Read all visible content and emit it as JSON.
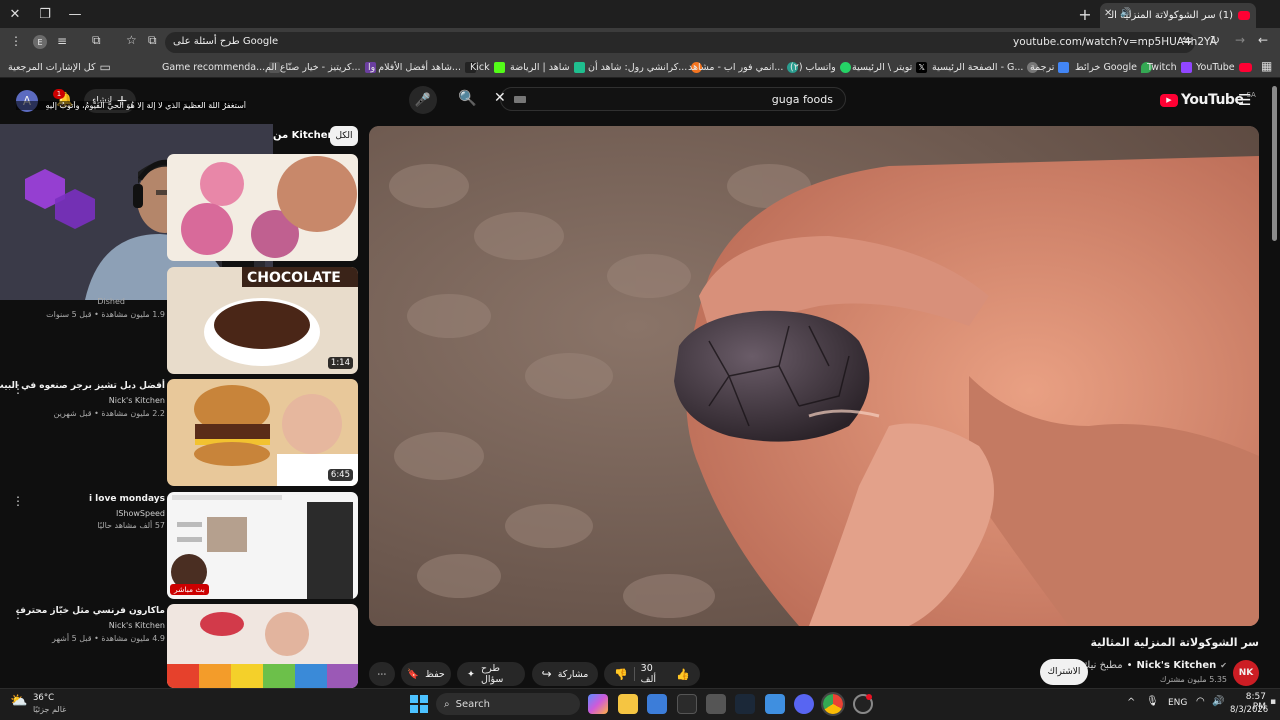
{
  "browser": {
    "tab_title": "(1) سر الشوكولاتة المنزلية الـ",
    "new_tab_symbol": "+",
    "url": "youtube.com/watch?v=mp5HUA4h2YA",
    "ask_google": "طرح أسئلة على Google",
    "profile_letter": "E",
    "bookmarks": [
      "YouTube",
      "Twitch",
      "خرائط Google",
      "ترجمة",
      "الصفحة الرئيسية - G...",
      "تويتر \\ الرئيسية",
      "واتساب (٢)",
      "انمي فور اب - مشاهد...",
      "كرانشي رول: شاهد أن...",
      "شاهد | الرياضة",
      "Kick",
      "شاهد أفضل الأفلام وا...",
      "كريتيز - خيار صنّاع الم...",
      "Game recommenda..."
    ],
    "bookmarks_folder": "كل الإشارات المرجعية"
  },
  "youtube": {
    "logo": "YouTube",
    "region": "SA",
    "search_query": "guga foods",
    "avatar_letter": "A",
    "notif_count": "1",
    "create_label": "إنشاء",
    "ticker_text": "أستغفرُ اللهَ العظيمَ الذي لا إلهَ إلا هُوَ الحيُّ القيُّومُ، وأتوبُ إليهِ",
    "chips": [
      "الكل",
      "من Kitchen"
    ]
  },
  "video": {
    "title": "سر الشوكولاتة المنزلية المثالية",
    "channel": "Nick's Kitchen",
    "channel_ar": "مطبخ نيك",
    "channel_initials": "NK",
    "subscribers": "5.35 مليون مشترك",
    "subscribe": "الاشتراك",
    "likes": "30 ألف",
    "share": "مشاركة",
    "ask": "طرح سؤال",
    "save": "حفظ"
  },
  "sidebar": [
    {
      "title": "",
      "channel": "Dished",
      "meta": "1.9 مليون مشاهدة • قبل 5 سنوات",
      "duration": "1:14",
      "thumb_text": "CHOCOLATE"
    },
    {
      "title": "أفضل دبل تشيز برجر صنعوه في البيت",
      "channel": "Nick's Kitchen",
      "meta": "2.2 مليون مشاهدة • قبل شهرين",
      "duration": "6:45"
    },
    {
      "title": "i love mondays",
      "channel": "IShowSpeed",
      "meta": "57 ألف مشاهد حاليًا",
      "live": "بث مباشر"
    },
    {
      "title": "ماكارون فرنسي مثل خبّاز محترف",
      "channel": "Nick's Kitchen",
      "meta": "4.9 مليون مشاهدة • قبل 5 أشهر"
    }
  ],
  "taskbar": {
    "weather_temp": "36°C",
    "weather_desc": "غالم جزئيًا",
    "search": "Search",
    "lang": "ENG",
    "time": "8:57 PM",
    "date": "8/3/2026"
  },
  "colors": {
    "youtube_red": "#ff0033",
    "bg": "#0f0f0f",
    "chrome": "#3c3c3c"
  }
}
